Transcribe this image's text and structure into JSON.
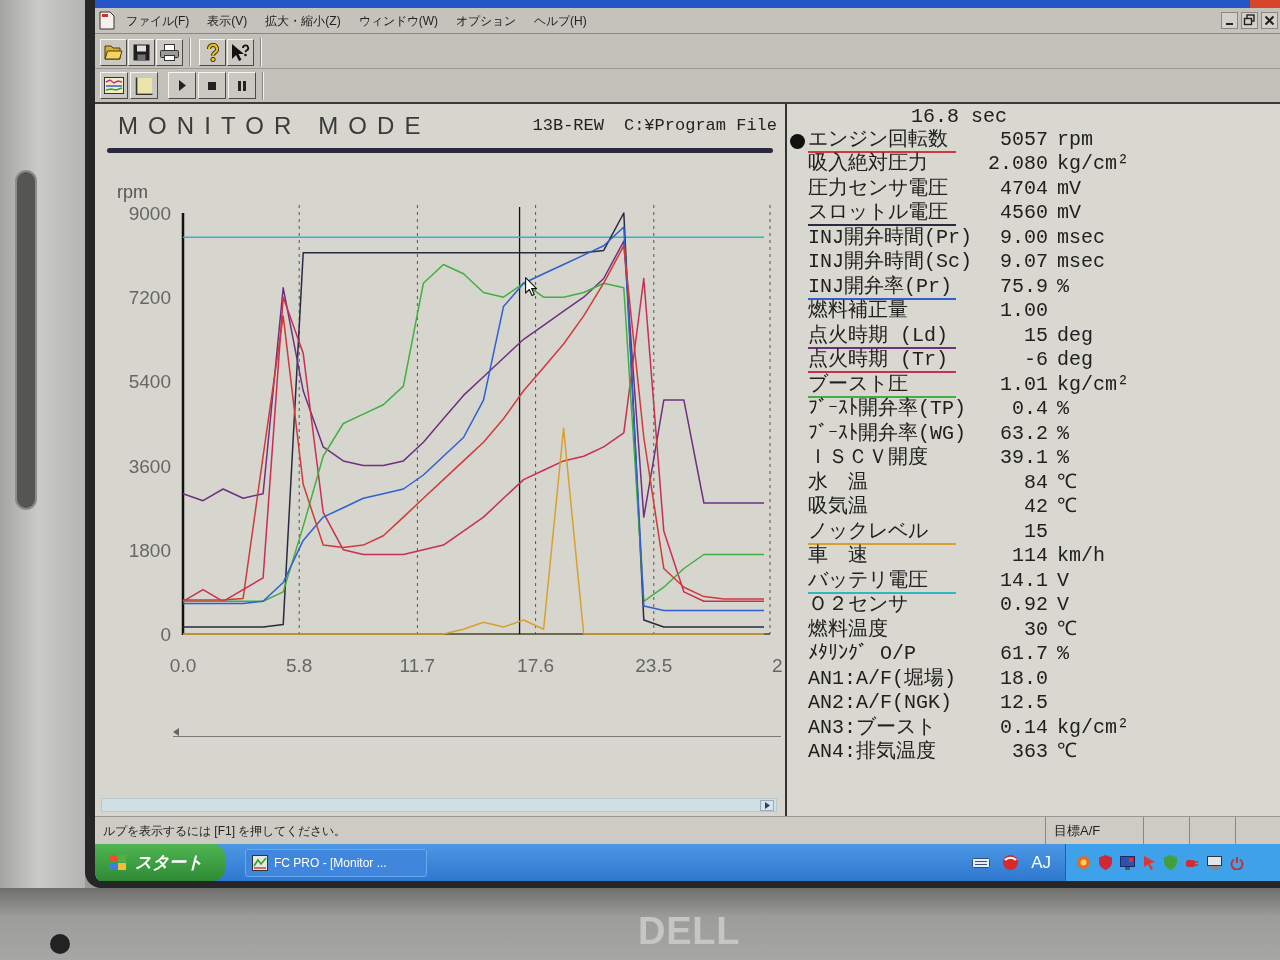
{
  "menu_bar": {
    "items": [
      "ファイル(F)",
      "表示(V)",
      "拡大・縮小(Z)",
      "ウィンドウ(W)",
      "オプション",
      "ヘルプ(H)"
    ]
  },
  "monitor": {
    "title": "MONITOR MODE",
    "engine": "13B-REW",
    "file_path": "C:¥Program File",
    "x_edge_label": "2",
    "chart_data": {
      "type": "line",
      "ylabel": "rpm",
      "x": [
        0,
        1,
        2,
        3,
        4,
        5,
        6,
        7,
        8,
        9,
        10,
        11,
        12,
        13,
        14,
        15,
        16,
        17,
        18,
        19,
        20,
        21,
        22,
        23,
        24,
        25,
        26,
        27,
        28,
        29
      ],
      "xlim": [
        0,
        29.3
      ],
      "ylim": [
        0,
        9000
      ],
      "xticks": [
        {
          "value": 0,
          "label": "0.0"
        },
        {
          "value": 5.8,
          "label": "5.8"
        },
        {
          "value": 11.7,
          "label": "11.7"
        },
        {
          "value": 17.6,
          "label": "17.6"
        },
        {
          "value": 23.5,
          "label": "23.5"
        }
      ],
      "yticks": [
        0,
        1800,
        3600,
        5400,
        7200,
        9000
      ],
      "grid": true,
      "series": [
        {
          "color": "#30b8c0",
          "values": [
            8480,
            8480,
            8480,
            8480,
            8480,
            8480,
            8480,
            8480,
            8480,
            8480,
            8480,
            8480,
            8480,
            8480,
            8480,
            8480,
            8480,
            8480,
            8480,
            8480,
            8480,
            8480,
            8480,
            8480,
            8480,
            8480,
            8480,
            8480,
            8480,
            8480
          ]
        },
        {
          "color": "#2a2a40",
          "values": [
            150,
            150,
            150,
            150,
            150,
            200,
            8150,
            8150,
            8150,
            8150,
            8150,
            8150,
            8150,
            8150,
            8150,
            8150,
            8150,
            8150,
            8150,
            8150,
            8150,
            8200,
            9000,
            300,
            150,
            150,
            150,
            150,
            150,
            150
          ]
        },
        {
          "color": "#703080",
          "values": [
            3000,
            2850,
            3100,
            2900,
            3000,
            7400,
            5200,
            4000,
            3700,
            3600,
            3600,
            3700,
            4100,
            4600,
            5100,
            5500,
            5900,
            6300,
            6600,
            6900,
            7200,
            7600,
            8400,
            2500,
            5000,
            5000,
            2800,
            2800,
            2800,
            2800
          ]
        },
        {
          "color": "#c83050",
          "values": [
            700,
            950,
            700,
            950,
            1200,
            7200,
            6000,
            2600,
            1800,
            1700,
            1700,
            1700,
            1800,
            1900,
            2200,
            2500,
            2900,
            3300,
            3500,
            3700,
            3800,
            4000,
            4300,
            7600,
            2200,
            900,
            700,
            700,
            700,
            700
          ]
        },
        {
          "color": "#40b040",
          "values": [
            700,
            700,
            700,
            700,
            700,
            900,
            2300,
            3800,
            4500,
            4700,
            4900,
            5300,
            7500,
            7900,
            7700,
            7300,
            7200,
            7500,
            7200,
            7200,
            7300,
            7500,
            7400,
            700,
            1000,
            1400,
            1700,
            1700,
            1700,
            1700
          ]
        },
        {
          "color": "#3060d0",
          "values": [
            650,
            650,
            650,
            650,
            700,
            1100,
            2000,
            2500,
            2700,
            2900,
            3000,
            3100,
            3400,
            3800,
            4200,
            5000,
            7000,
            7500,
            7700,
            7900,
            8100,
            8300,
            8700,
            600,
            500,
            500,
            500,
            500,
            500,
            500
          ]
        },
        {
          "color": "#d03a3a",
          "values": [
            730,
            730,
            730,
            760,
            3800,
            6800,
            3200,
            1900,
            1850,
            1900,
            2100,
            2500,
            2900,
            3300,
            3700,
            4100,
            4600,
            5200,
            5700,
            6200,
            6800,
            7500,
            8300,
            4200,
            1400,
            1000,
            800,
            750,
            750,
            750
          ]
        },
        {
          "color": "#d8a030",
          "values": [
            0,
            0,
            0,
            0,
            0,
            0,
            0,
            0,
            0,
            0,
            0,
            0,
            0,
            0,
            100,
            250,
            150,
            300,
            100,
            4400,
            0,
            0,
            0,
            0,
            0,
            0,
            0,
            0,
            0,
            0
          ]
        }
      ],
      "ref_lines": [
        {
          "axis": "x",
          "value": 16.8
        }
      ]
    }
  },
  "readout": {
    "time": "16.8 sec",
    "rows": [
      {
        "label": "エンジン回転数",
        "value": "5057",
        "unit": "rpm",
        "selected": true,
        "color": "#d03a3a"
      },
      {
        "label": "吸入絶対圧力",
        "value": "2.080",
        "unit": "kg/cm²",
        "selected": false
      },
      {
        "label": "圧力センサ電圧",
        "value": "4704",
        "unit": "mV",
        "selected": false
      },
      {
        "label": "スロットル電圧",
        "value": "4560",
        "unit": "mV",
        "selected": false,
        "color": "#2a2a40"
      },
      {
        "label": "INJ開弁時間(Pr)",
        "value": "9.00",
        "unit": "msec",
        "selected": false
      },
      {
        "label": "INJ開弁時間(Sc)",
        "value": "9.07",
        "unit": "msec",
        "selected": false
      },
      {
        "label": "INJ開弁率(Pr)",
        "value": "75.9",
        "unit": "%",
        "selected": false,
        "color": "#3060d0"
      },
      {
        "label": "燃料補正量",
        "value": "1.00",
        "selected": false
      },
      {
        "label": "点火時期 (Ld)",
        "value": "15",
        "unit": "deg",
        "selected": false,
        "color": "#703080"
      },
      {
        "label": "点火時期 (Tr)",
        "value": "-6",
        "unit": "deg",
        "selected": false,
        "color": "#c83050"
      },
      {
        "label": "ブースト圧",
        "value": "1.01",
        "unit": "kg/cm²",
        "selected": false,
        "color": "#40b040"
      },
      {
        "label": "ﾌﾞｰｽﾄ開弁率(TP)",
        "value": "0.4",
        "unit": "%",
        "selected": false
      },
      {
        "label": "ﾌﾞｰｽﾄ開弁率(WG)",
        "value": "63.2",
        "unit": "%",
        "selected": false
      },
      {
        "label": "ＩＳＣＶ開度",
        "value": "39.1",
        "unit": "%",
        "selected": false
      },
      {
        "label": "水　温",
        "value": "84",
        "unit": "℃",
        "selected": false
      },
      {
        "label": "吸気温",
        "value": "42",
        "unit": "℃",
        "selected": false
      },
      {
        "label": "ノックレベル",
        "value": "15",
        "selected": false,
        "color": "#d8a030"
      },
      {
        "label": "車　速",
        "value": "114",
        "unit": "km/h",
        "selected": false
      },
      {
        "label": "バッテリ電圧",
        "value": "14.1",
        "unit": "V",
        "selected": false,
        "color": "#30b8c0"
      },
      {
        "label": "Ｏ２センサ",
        "value": "0.92",
        "unit": "V",
        "selected": false
      },
      {
        "label": "燃料温度",
        "value": "30",
        "unit": "℃",
        "selected": false
      },
      {
        "label": "ﾒﾀﾘﾝｸﾞ O/P",
        "value": "61.7",
        "unit": "%",
        "selected": false
      },
      {
        "label": "AN1:A/F(堀場)",
        "value": "18.0",
        "selected": false
      },
      {
        "label": "AN2:A/F(NGK)",
        "value": "12.5",
        "selected": false
      },
      {
        "label": "AN3:ブースト",
        "value": "0.14",
        "unit": "kg/cm²",
        "selected": false
      },
      {
        "label": "AN4:排気温度",
        "value": "363",
        "unit": "℃",
        "selected": false
      }
    ]
  },
  "status_bar": {
    "help": "ルプを表示するには [F1] を押してください。",
    "target_af": "目標A/F"
  },
  "taskbar": {
    "start": "スタート",
    "task": "FC PRO - [Monitor ...",
    "ime": "AJ"
  },
  "bezel": {
    "logo": "DELL"
  }
}
